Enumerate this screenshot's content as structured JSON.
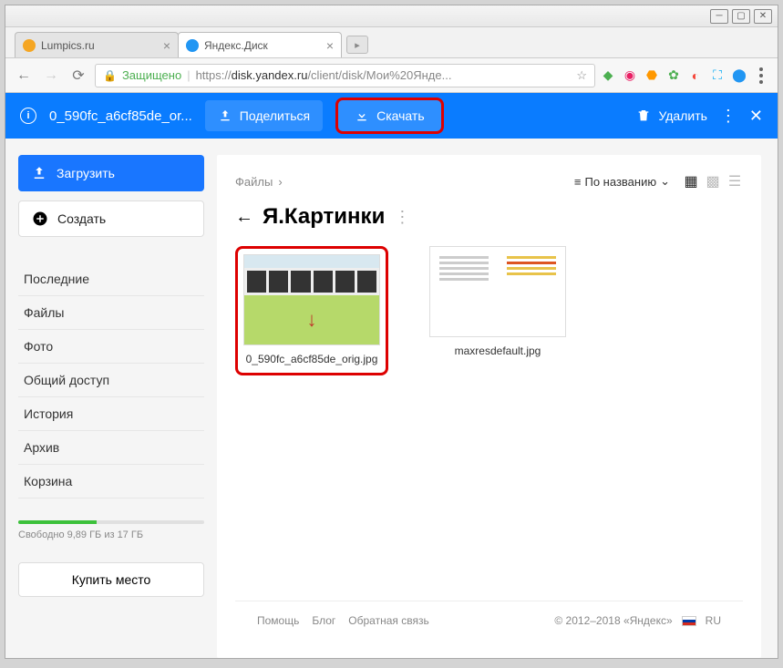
{
  "tabs": [
    {
      "title": "Lumpics.ru",
      "favicon_color": "#f5a623"
    },
    {
      "title": "Яндекс.Диск",
      "favicon_color": "#2196f3"
    }
  ],
  "addressbar": {
    "secure_label": "Защищено",
    "url_prefix": "https://",
    "url_host": "disk.yandex.ru",
    "url_path": "/client/disk/Мои%20Янде..."
  },
  "header": {
    "filename": "0_590fc_a6cf85de_or...",
    "share": "Поделиться",
    "download": "Скачать",
    "delete": "Удалить"
  },
  "sidebar": {
    "upload": "Загрузить",
    "create": "Создать",
    "items": [
      "Последние",
      "Файлы",
      "Фото",
      "Общий доступ",
      "История",
      "Архив",
      "Корзина"
    ],
    "storage_text": "Свободно 9,89 ГБ из 17 ГБ",
    "storage_fill_pct": 42,
    "buy": "Купить место"
  },
  "main": {
    "breadcrumb": "Файлы",
    "sort_label": "По названию",
    "title": "Я.Картинки",
    "files": [
      {
        "name": "0_590fc_a6cf85de_orig.jpg"
      },
      {
        "name": "maxresdefault.jpg"
      }
    ]
  },
  "footer": {
    "help": "Помощь",
    "blog": "Блог",
    "feedback": "Обратная связь",
    "copyright": "© 2012–2018 «Яндекс»",
    "lang": "RU"
  }
}
